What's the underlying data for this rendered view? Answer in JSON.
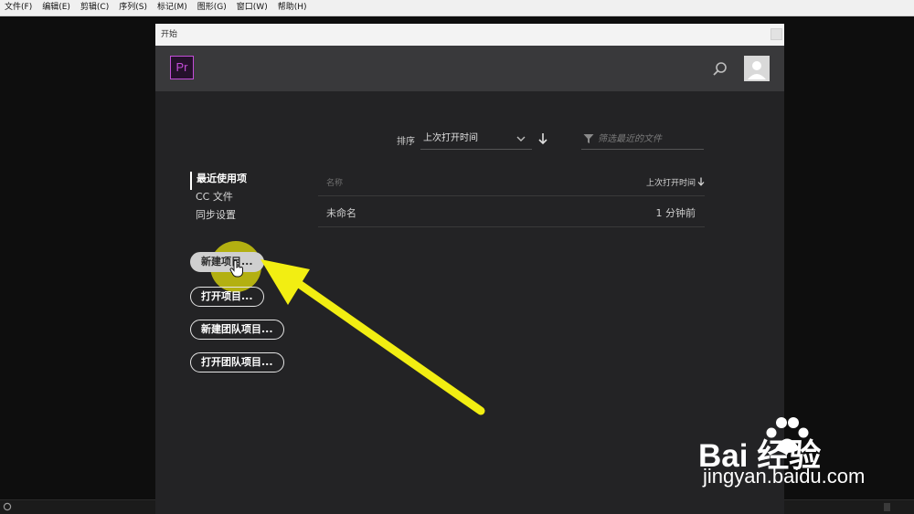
{
  "menu": [
    "文件(F)",
    "编辑(E)",
    "剪辑(C)",
    "序列(S)",
    "标记(M)",
    "图形(G)",
    "窗口(W)",
    "帮助(H)"
  ],
  "dialog": {
    "title": "开始",
    "logo_text": "Pr",
    "sort": {
      "label": "排序",
      "value": "上次打开时间"
    },
    "filter": {
      "placeholder": "筛选最近的文件"
    },
    "nav": [
      "最近使用项",
      "CC 文件",
      "同步设置"
    ],
    "buttons": [
      "新建项目...",
      "打开项目...",
      "新建团队项目...",
      "打开团队项目..."
    ],
    "files": {
      "columns": {
        "name": "名称",
        "time": "上次打开时间"
      },
      "rows": [
        {
          "name": "未命名",
          "time": "1 分钟前"
        }
      ]
    }
  },
  "watermark": {
    "logo": "Bai  经验",
    "url": "jingyan.baidu.com"
  },
  "colors": {
    "accent_pr": "#c34dd8",
    "highlight": "#ebe80a",
    "arrow": "#f2ee12"
  }
}
